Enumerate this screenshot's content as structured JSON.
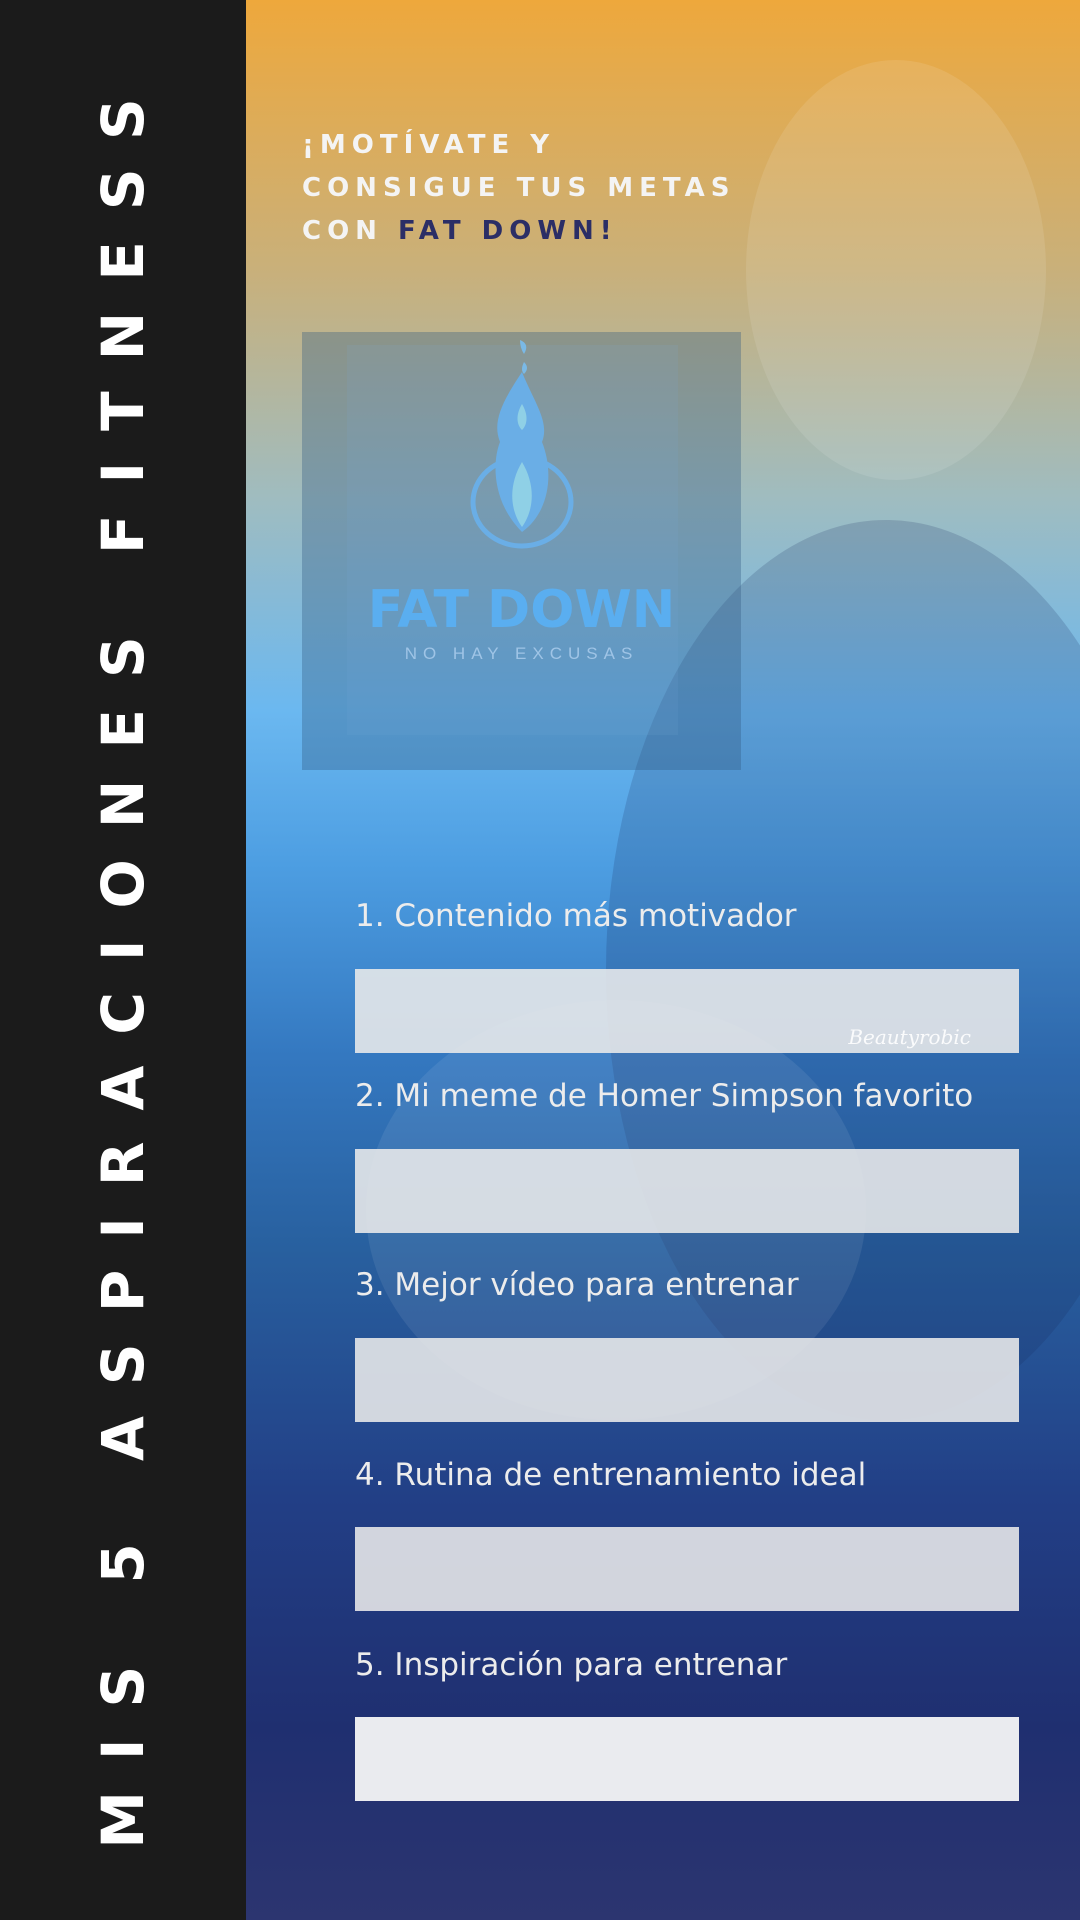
{
  "sidebar": {
    "title": "MIS 5 ASPIRACIONES FITNESS"
  },
  "header": {
    "line_white": "¡MOTÍVATE Y CONSIGUE TUS METAS CON ",
    "line_brand": "FAT DOWN!"
  },
  "logo": {
    "name": "FAT DOWN",
    "tagline": "NO HAY EXCUSAS",
    "icon": "flame-icon"
  },
  "watermark": "Beautyrobic",
  "questions": [
    {
      "label": "1. Contenido más motivador",
      "value": ""
    },
    {
      "label": "2. Mi meme de Homer Simpson favorito",
      "value": ""
    },
    {
      "label": "3. Mejor vídeo para entrenar",
      "value": ""
    },
    {
      "label": "4. Rutina de entrenamiento ideal",
      "value": ""
    },
    {
      "label": "5. Inspiración para entrenar",
      "value": ""
    }
  ],
  "colors": {
    "sidebar": "#1b1b1b",
    "brand": "#2b2e66",
    "logo": "#5aaef0"
  }
}
